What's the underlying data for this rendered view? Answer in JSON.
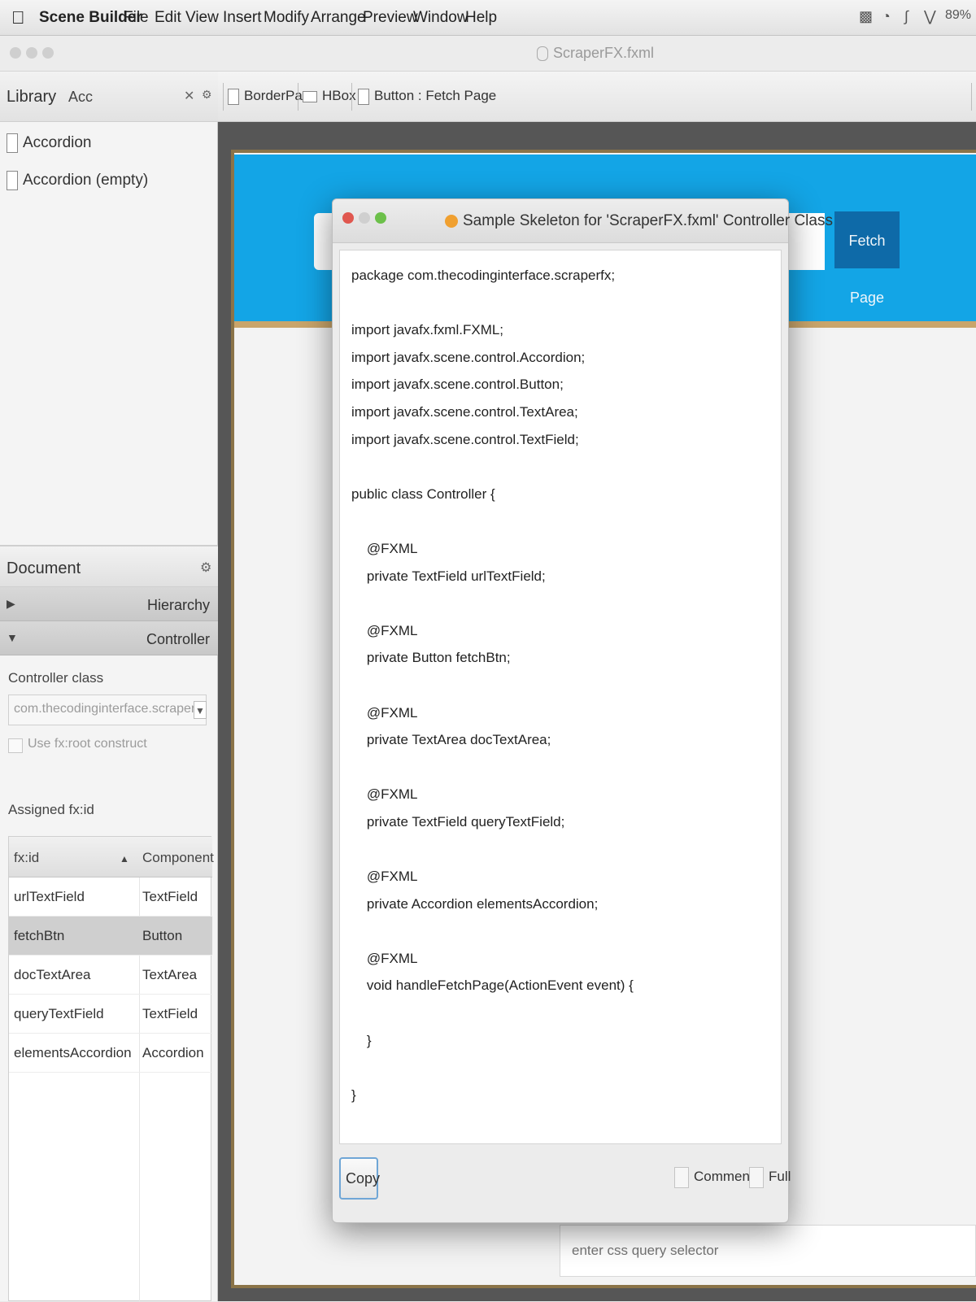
{
  "menubar": {
    "apple": "",
    "app": "Scene Builder",
    "items": [
      "File",
      "Edit",
      "View",
      "Insert",
      "Modify",
      "Arrange",
      "Preview",
      "Window",
      "Help"
    ],
    "battery": "89%"
  },
  "window": {
    "title": "ScraperFX.fxml"
  },
  "library": {
    "label": "Library",
    "search_value": "Acc",
    "items": [
      "Accordion",
      "Accordion  (empty)"
    ]
  },
  "document": {
    "label": "Document",
    "sections": [
      "Hierarchy",
      "Controller"
    ],
    "controller_class_label": "Controller class",
    "controller_class_value": "com.thecodinginterface.scraperfx.Controller",
    "use_fx_root_label": "Use fx:root construct",
    "assigned_label": "Assigned fx:id",
    "table": {
      "headers": [
        "fx:id",
        "Component"
      ],
      "rows": [
        {
          "id": "urlTextField",
          "component": "TextField"
        },
        {
          "id": "fetchBtn",
          "component": "Button"
        },
        {
          "id": "docTextArea",
          "component": "TextArea"
        },
        {
          "id": "queryTextField",
          "component": "TextField"
        },
        {
          "id": "elementsAccordion",
          "component": "Accordion"
        }
      ]
    }
  },
  "breadcrumbs": [
    "BorderPane",
    "HBox",
    "Button : Fetch Page"
  ],
  "canvas": {
    "fetch_label": "Fetch Page",
    "query_placeholder": "enter css query selector",
    "colors": {
      "header": "#13a5e6",
      "button": "#0e6aa8",
      "border": "#c9a56b"
    }
  },
  "modal": {
    "title": "Sample Skeleton for 'ScraperFX.fxml' Controller Class",
    "code": "package com.thecodinginterface.scraperfx;\n\nimport javafx.fxml.FXML;\nimport javafx.scene.control.Accordion;\nimport javafx.scene.control.Button;\nimport javafx.scene.control.TextArea;\nimport javafx.scene.control.TextField;\n\npublic class Controller {\n\n    @FXML\n    private TextField urlTextField;\n\n    @FXML\n    private Button fetchBtn;\n\n    @FXML\n    private TextArea docTextArea;\n\n    @FXML\n    private TextField queryTextField;\n\n    @FXML\n    private Accordion elementsAccordion;\n\n    @FXML\n    void handleFetchPage(ActionEvent event) {\n\n    }\n\n}",
    "copy_label": "Copy",
    "comments_label": "Comments",
    "full_label": "Full"
  }
}
